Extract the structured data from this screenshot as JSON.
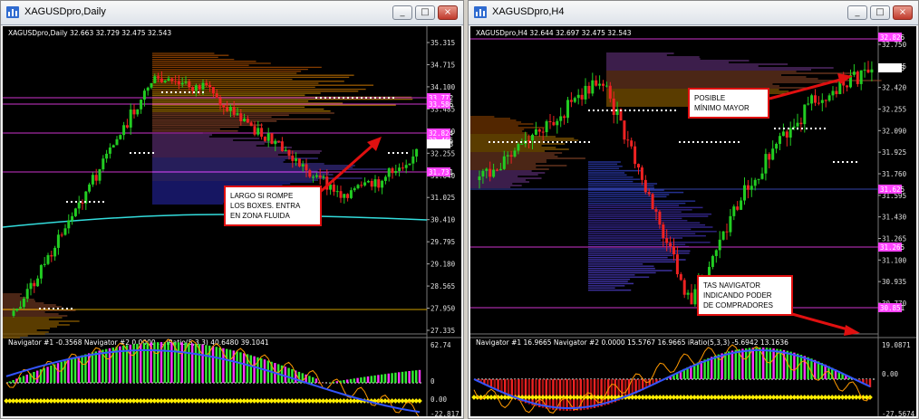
{
  "colors": {
    "accent_red": "#e01010",
    "bg": "#000000",
    "price_box_magenta": "#ff44ff"
  },
  "left": {
    "title": "XAGUSDpro,Daily",
    "ohlc_label": "XAGUSDpro,Daily  32.663 32.729 32.475 32.543",
    "price_ticks": [
      "35.315",
      "34.715",
      "34.100",
      "33.485",
      "32.870",
      "32.255",
      "31.640",
      "31.025",
      "30.410",
      "29.795",
      "29.180",
      "28.565",
      "27.950",
      "27.335"
    ],
    "price_boxes": [
      "33.772",
      "33.586",
      "32.824",
      "32.465",
      "32.543",
      "31.731"
    ],
    "current_price": "32.543",
    "navigator_label": "Navigator #1 -0.3568  Navigator #2 0.0000 ... iRatio(5,3,3) 40.6480 39.1041",
    "nav_ticks": [
      "62.74",
      "0",
      "0.00",
      "-22.817"
    ],
    "callout": [
      "LARGO SI ROMPE",
      "LOS BOXES. ENTRA",
      "EN ZONA FLUIDA"
    ]
  },
  "right": {
    "title": "XAGUSDpro,H4",
    "ohlc_label": "XAGUSDpro,H4  32.644 32.697 32.475 32.543",
    "price_ticks": [
      "32.750",
      "32.585",
      "32.420",
      "32.255",
      "32.090",
      "31.925",
      "31.760",
      "31.595",
      "31.430",
      "31.265",
      "31.100",
      "30.935",
      "30.770"
    ],
    "price_boxes": [
      "32.826",
      "32.543",
      "31.625",
      "31.265",
      "30.851"
    ],
    "current_price": "32.543",
    "navigator_label": "Navigator #1 16.9665  Navigator #2 0.0000  15.5767 16.9665  iRatio(5,3,3) -5.6942 13.1636",
    "nav_ticks": [
      "19.0871",
      "0.00",
      "-27.5674"
    ],
    "callout1": [
      "POSIBLE",
      "MÍNIMO MAYOR"
    ],
    "callout2": [
      "TAS NAVIGATOR",
      "INDICANDO PODER",
      "DE COMPRADORES"
    ]
  },
  "window_buttons": {
    "minimize": "_",
    "maximize": "□",
    "close": "×"
  },
  "icon": "chart-window-icon"
}
